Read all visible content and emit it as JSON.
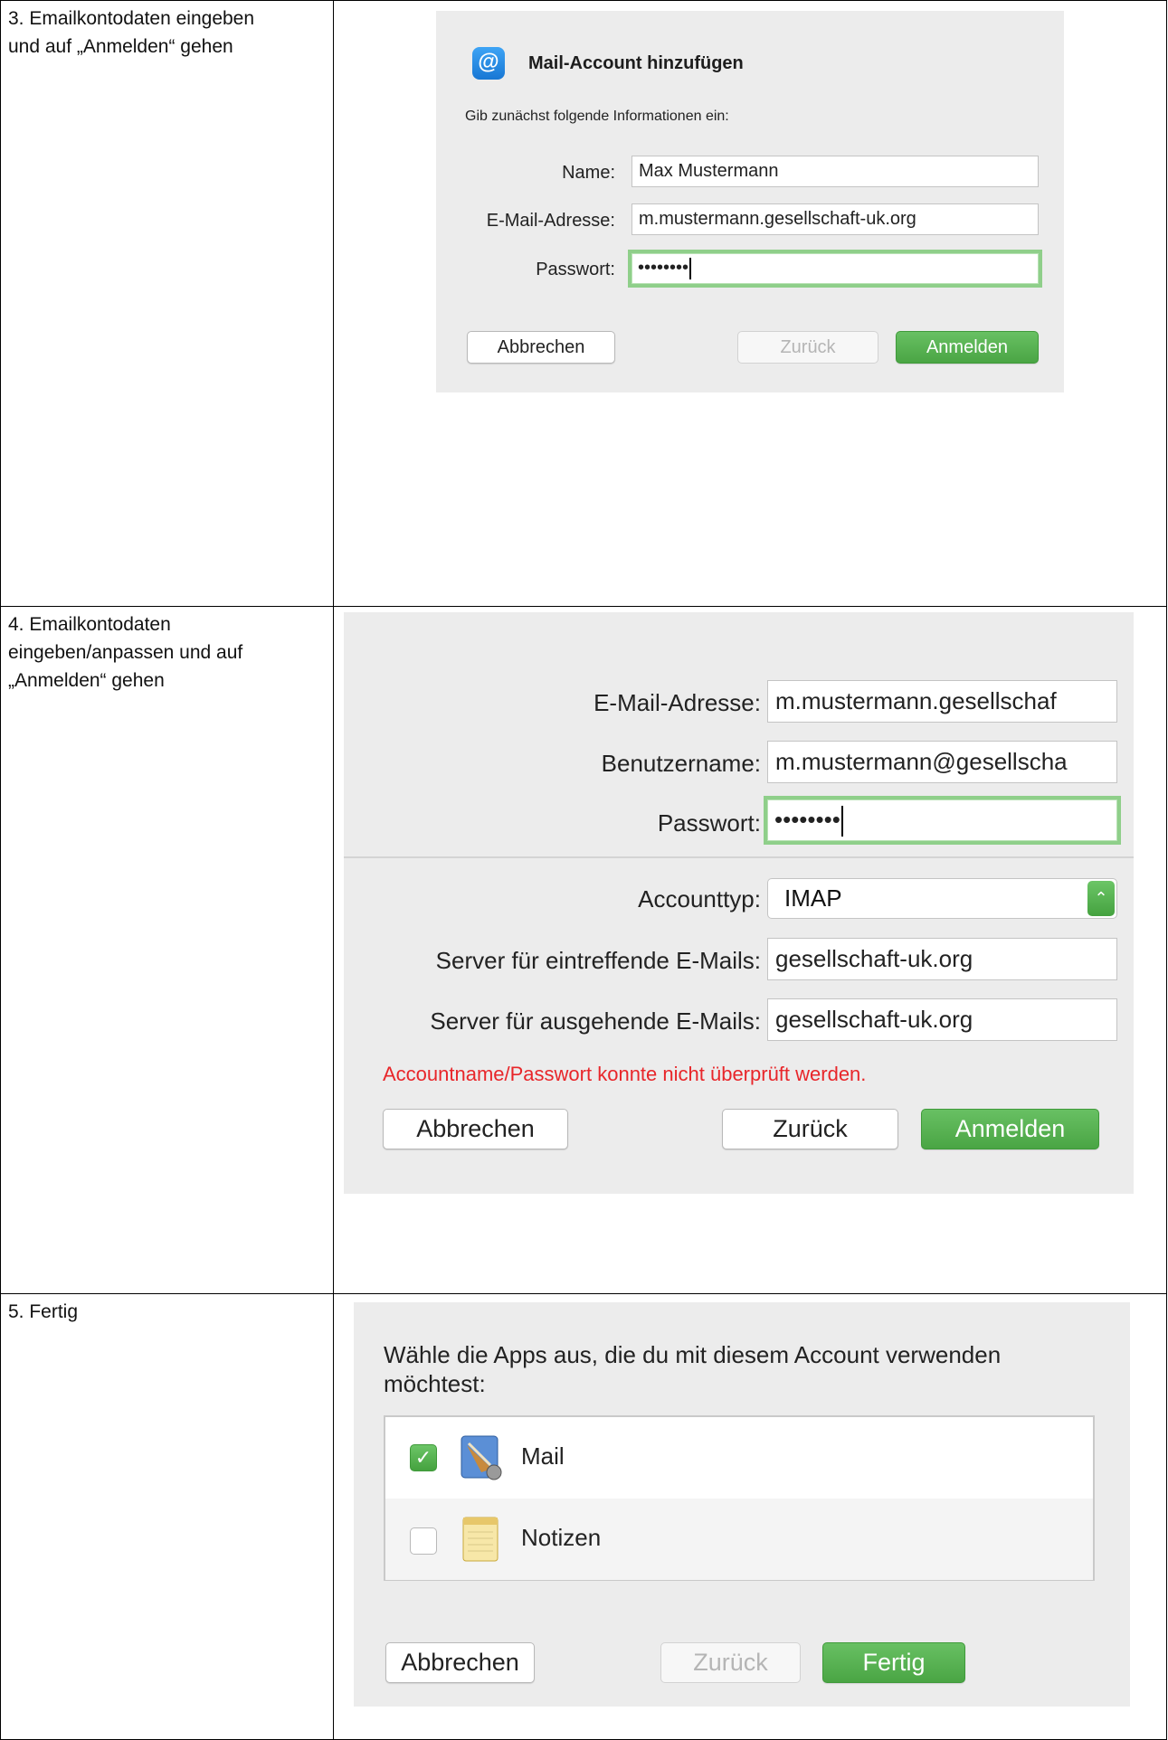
{
  "steps": [
    "3. Emailkontodaten eingeben\nund auf „Anmelden“ gehen",
    "4. Emailkontodaten\neingeben/anpassen und auf\n„Anmelden“ gehen",
    "5. Fertig"
  ],
  "panel1": {
    "icon_glyph": "@",
    "title": "Mail-Account hinzufügen",
    "intro": "Gib zunächst folgende Informationen ein:",
    "name_label": "Name:",
    "name_value": "Max Mustermann",
    "email_label": "E-Mail-Adresse:",
    "email_value": "m.mustermann.gesellschaft-uk.org",
    "password_label": "Passwort:",
    "password_value": "••••••••",
    "cancel": "Abbrechen",
    "back": "Zurück",
    "login": "Anmelden"
  },
  "panel2": {
    "email_label": "E-Mail-Adresse:",
    "email_value": "m.mustermann.gesellschaf",
    "username_label": "Benutzername:",
    "username_value": "m.mustermann@gesellscha",
    "password_label": "Passwort:",
    "password_value": "••••••••",
    "account_type_label": "Accounttyp:",
    "account_type_value": "IMAP",
    "incoming_label": "Server für eintreffende E-Mails:",
    "incoming_value": "gesellschaft-uk.org",
    "outgoing_label": "Server für ausgehende E-Mails:",
    "outgoing_value": "gesellschaft-uk.org",
    "error": "Accountname/Passwort konnte nicht überprüft werden.",
    "cancel": "Abbrechen",
    "back": "Zurück",
    "login": "Anmelden"
  },
  "panel3": {
    "prompt": "Wähle die Apps aus, die du mit diesem Account verwenden möchtest:",
    "apps": [
      {
        "label": "Mail",
        "checked": true
      },
      {
        "label": "Notizen",
        "checked": false
      }
    ],
    "cancel": "Abbrechen",
    "back": "Zurück",
    "done": "Fertig"
  },
  "colors": {
    "accent_green": "#4aa544",
    "error_red": "#e8262a",
    "panel_bg": "#ececec"
  }
}
